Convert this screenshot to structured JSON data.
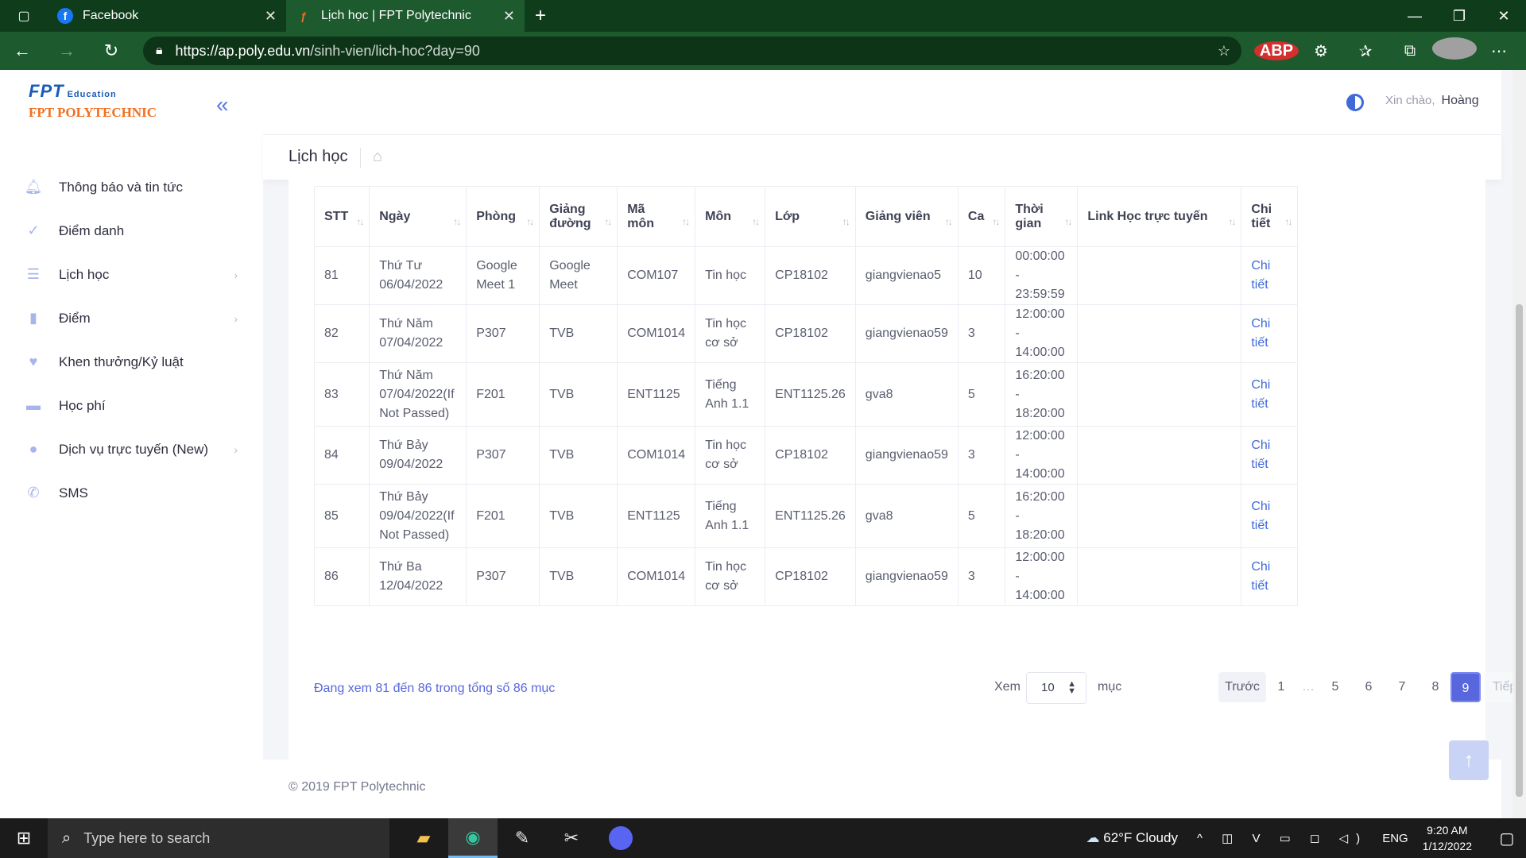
{
  "browser": {
    "tabs": [
      {
        "label": "Facebook",
        "icon": "facebook-icon"
      },
      {
        "label": "Lịch học | FPT Polytechnic",
        "icon": "fpt-icon"
      }
    ],
    "url_host": "https://ap.poly.edu.vn",
    "url_path": "/sinh-vien/lich-hoc?day=90",
    "abp_label": "ABP"
  },
  "logo": {
    "brand": "FPT",
    "edu": "Education",
    "name": "FPT POLYTECHNIC"
  },
  "sidebar": {
    "items": [
      {
        "label": "Thông báo và tin tức",
        "icon": "bell-icon",
        "has_arrow": false
      },
      {
        "label": "Điểm danh",
        "icon": "check-icon",
        "has_arrow": false
      },
      {
        "label": "Lịch học",
        "icon": "list-icon",
        "has_arrow": true
      },
      {
        "label": "Điểm",
        "icon": "book-icon",
        "has_arrow": true
      },
      {
        "label": "Khen thưởng/Kỷ luật",
        "icon": "heart-icon",
        "has_arrow": false
      },
      {
        "label": "Học phí",
        "icon": "card-icon",
        "has_arrow": false
      },
      {
        "label": "Dịch vụ trực tuyến (New)",
        "icon": "globe-icon",
        "has_arrow": true
      },
      {
        "label": "SMS",
        "icon": "phone-icon",
        "has_arrow": false
      }
    ]
  },
  "header": {
    "greeting": "Xin chào,",
    "user": "Hoàng"
  },
  "subheader": {
    "title": "Lịch học"
  },
  "table": {
    "columns": [
      "STT",
      "Ngày",
      "Phòng",
      "Giảng đường",
      "Mã môn",
      "Môn",
      "Lớp",
      "Giảng viên",
      "Ca",
      "Thời gian",
      "Link Học trực tuyến",
      "Chi tiết"
    ],
    "rows": [
      [
        "81",
        "Thứ Tư 06/04/2022",
        "Google Meet 1",
        "Google Meet",
        "COM107",
        "Tin học",
        "CP18102",
        "giangvienao5",
        "10",
        "00:00:00 - 23:59:59",
        "",
        "Chi tiết"
      ],
      [
        "82",
        "Thứ Năm 07/04/2022",
        "P307",
        "TVB",
        "COM1014",
        "Tin học cơ sở",
        "CP18102",
        "giangvienao59",
        "3",
        "12:00:00 - 14:00:00",
        "",
        "Chi tiết"
      ],
      [
        "83",
        "Thứ Năm 07/04/2022(If Not Passed)",
        "F201",
        "TVB",
        "ENT1125",
        "Tiếng Anh 1.1",
        "ENT1125.26",
        "gva8",
        "5",
        "16:20:00 - 18:20:00",
        "",
        "Chi tiết"
      ],
      [
        "84",
        "Thứ Bảy 09/04/2022",
        "P307",
        "TVB",
        "COM1014",
        "Tin học cơ sở",
        "CP18102",
        "giangvienao59",
        "3",
        "12:00:00 - 14:00:00",
        "",
        "Chi tiết"
      ],
      [
        "85",
        "Thứ Bảy 09/04/2022(If Not Passed)",
        "F201",
        "TVB",
        "ENT1125",
        "Tiếng Anh 1.1",
        "ENT1125.26",
        "gva8",
        "5",
        "16:20:00 - 18:20:00",
        "",
        "Chi tiết"
      ],
      [
        "86",
        "Thứ Ba 12/04/2022",
        "P307",
        "TVB",
        "COM1014",
        "Tin học cơ sở",
        "CP18102",
        "giangvienao59",
        "3",
        "12:00:00 - 14:00:00",
        "",
        "Chi tiết"
      ]
    ]
  },
  "pager": {
    "info": "Đang xem 81 đến 86 trong tổng số 86 mục",
    "xem": "Xem",
    "page_size": "10",
    "muc": "mục",
    "prev": "Trước",
    "pages": [
      "1",
      "…",
      "5",
      "6",
      "7",
      "8",
      "9"
    ],
    "current": "9",
    "next": "Tiếp"
  },
  "footer": {
    "copyright": "© 2019 FPT Polytechnic"
  },
  "taskbar": {
    "search_placeholder": "Type here to search",
    "apps": [
      "file-explorer-icon",
      "edge-icon",
      "paint-icon",
      "snipping-icon",
      "discord-icon"
    ],
    "weather": "62°F  Cloudy",
    "lang": "ENG",
    "time": "9:20 AM",
    "date": "1/12/2022"
  }
}
